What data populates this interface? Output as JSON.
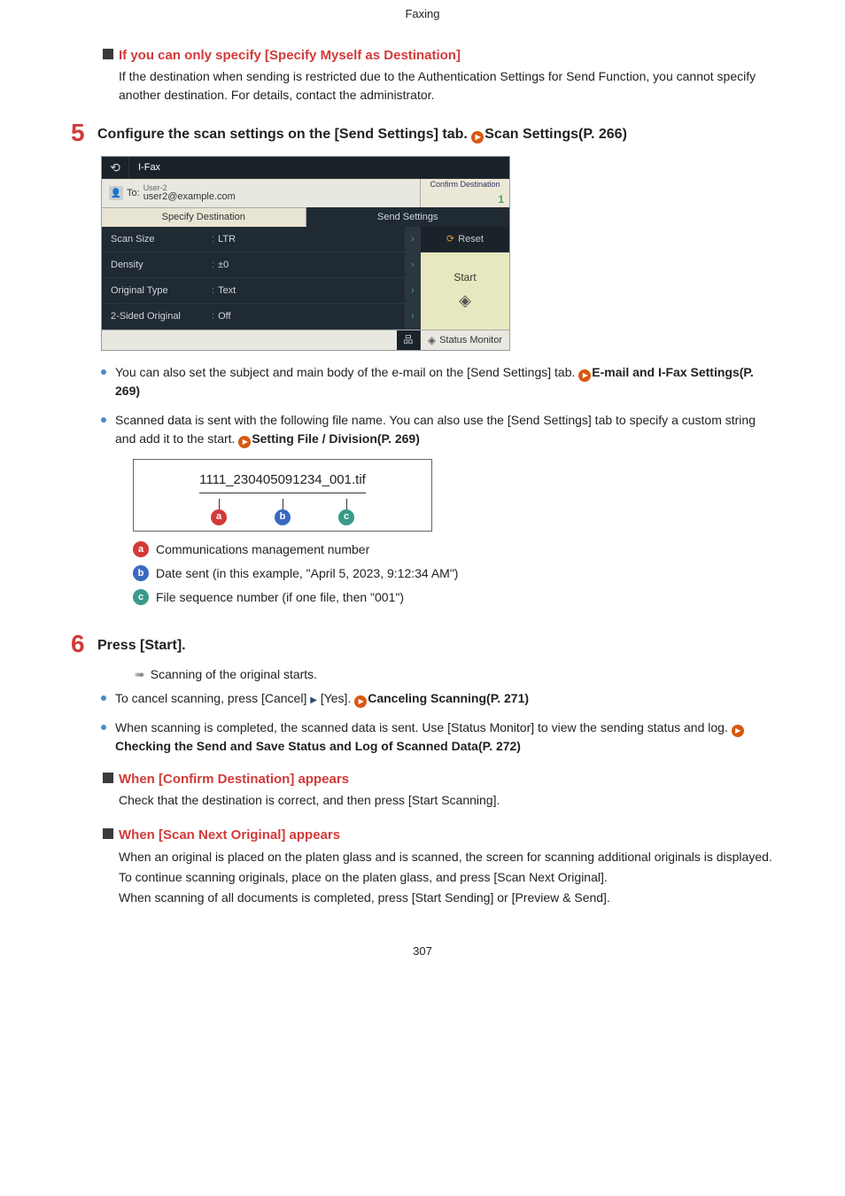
{
  "header": {
    "section": "Faxing"
  },
  "block1": {
    "title": "If you can only specify [Specify Myself as Destination]",
    "text": "If the destination when sending is restricted due to the Authentication Settings for Send Function, you cannot specify another destination. For details, contact the administrator."
  },
  "step5": {
    "num": "5",
    "title_before": "Configure the scan settings on the [Send Settings] tab. ",
    "link": "Scan Settings(P. 266)"
  },
  "screenshot": {
    "ifax": "I-Fax",
    "to_label": "To:",
    "to_user": "User-2",
    "to_email": "user2@example.com",
    "confirm_label": "Confirm Destination",
    "confirm_count": "1",
    "tab_specify": "Specify Destination",
    "tab_send": "Send Settings",
    "rows": [
      {
        "label": "Scan Size",
        "val": "LTR"
      },
      {
        "label": "Density",
        "val": "±0"
      },
      {
        "label": "Original Type",
        "val": "Text"
      },
      {
        "label": "2-Sided Original",
        "val": "Off"
      }
    ],
    "reset": "Reset",
    "start": "Start",
    "status": "Status Monitor"
  },
  "step5_bullet1_a": "You can also set the subject and main body of the e-mail on the [Send Settings] tab. ",
  "step5_bullet1_link": "E-mail and I-Fax Settings(P. 269)",
  "step5_bullet2_a": "Scanned data is sent with the following file name. You can also use the [Send Settings] tab to specify a custom string and add it to the start. ",
  "step5_bullet2_link": "Setting File / Division(P. 269)",
  "filename": {
    "a": "1111",
    "b": "230405091234",
    "c": "001",
    "ext": ".tif"
  },
  "legend": {
    "a": "Communications management number",
    "b": "Date sent (in this example, \"April 5, 2023, 9:12:34 AM\")",
    "c": "File sequence number (if one file, then \"001\")"
  },
  "step6": {
    "num": "6",
    "title": "Press [Start]."
  },
  "step6_scan": "Scanning of the original starts.",
  "step6_cancel_a": "To cancel scanning, press [Cancel] ",
  "step6_cancel_b": " [Yes]. ",
  "step6_cancel_link": "Canceling Scanning(P. 271)",
  "step6_done_a": "When scanning is completed, the scanned data is sent. Use [Status Monitor] to view the sending status and log. ",
  "step6_done_link": "Checking the Send and Save Status and Log of Scanned Data(P. 272)",
  "confirm_block": {
    "title": "When [Confirm Destination] appears",
    "text": "Check that the destination is correct, and then press [Start Scanning]."
  },
  "next_block": {
    "title": "When [Scan Next Original] appears",
    "text1": "When an original is placed on the platen glass and is scanned, the screen for scanning additional originals is displayed.",
    "text2": "To continue scanning originals, place on the platen glass, and press [Scan Next Original].",
    "text3": "When scanning of all documents is completed, press [Start Sending] or [Preview & Send]."
  },
  "footer": {
    "page": "307"
  }
}
